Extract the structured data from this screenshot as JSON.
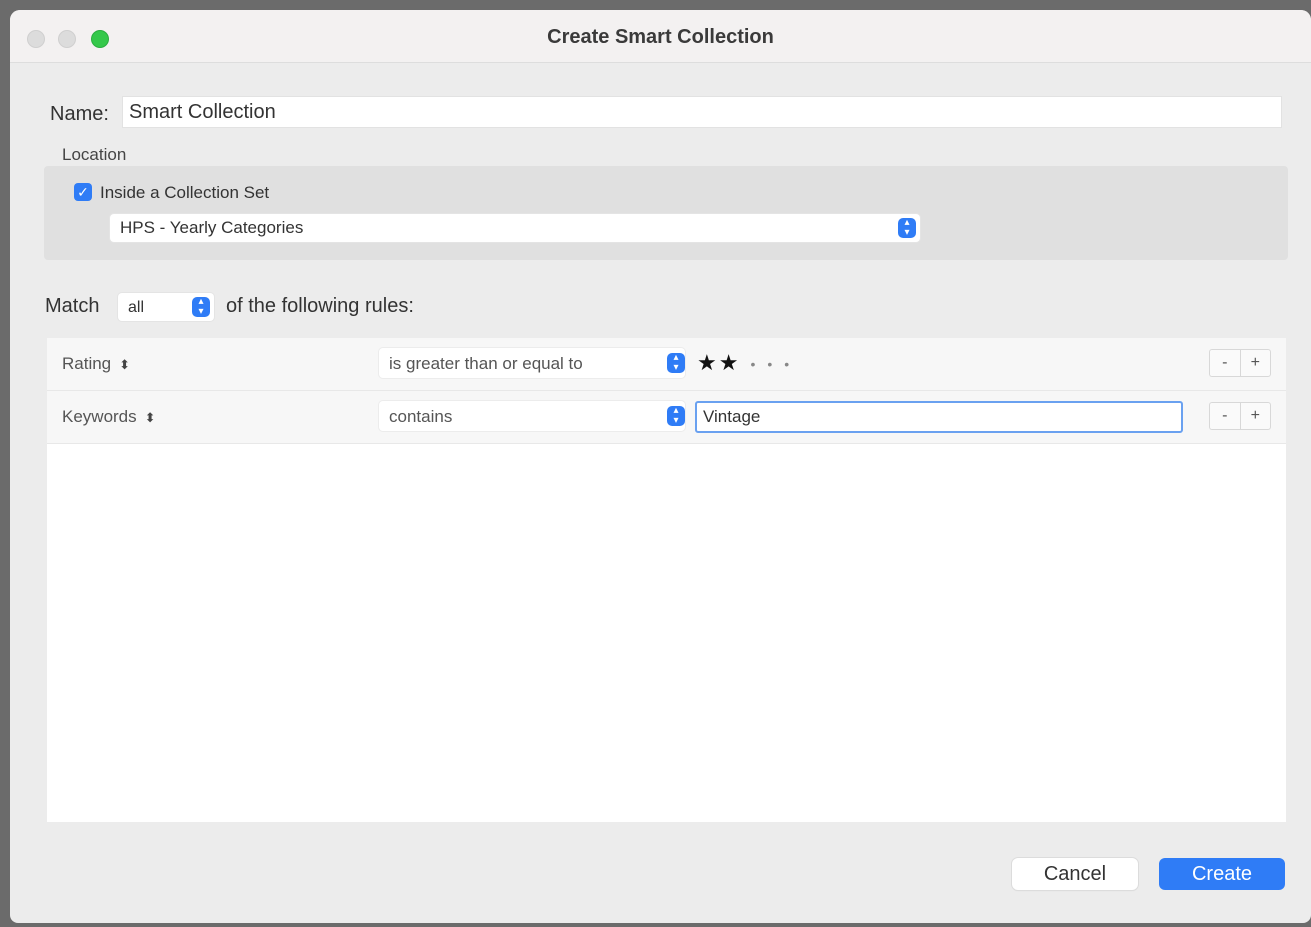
{
  "window": {
    "title": "Create Smart Collection"
  },
  "name": {
    "label": "Name:",
    "value": "Smart Collection"
  },
  "location": {
    "label": "Location",
    "checkbox_label": "Inside a Collection Set",
    "checked": true,
    "collection_set": "HPS - Yearly Categories"
  },
  "match": {
    "prefix": "Match",
    "value": "all",
    "suffix": "of the following rules:"
  },
  "rules": [
    {
      "field": "Rating",
      "operator": "is greater than or equal to",
      "rating_stars": 2,
      "rating_max": 5
    },
    {
      "field": "Keywords",
      "operator": "contains",
      "value": "Vintage"
    }
  ],
  "buttons": {
    "remove": "-",
    "add": "+",
    "cancel": "Cancel",
    "create": "Create"
  },
  "colors": {
    "accent": "#2f7cf6",
    "close_light": "#dcdcdc",
    "maximize_light": "#34c84a"
  }
}
